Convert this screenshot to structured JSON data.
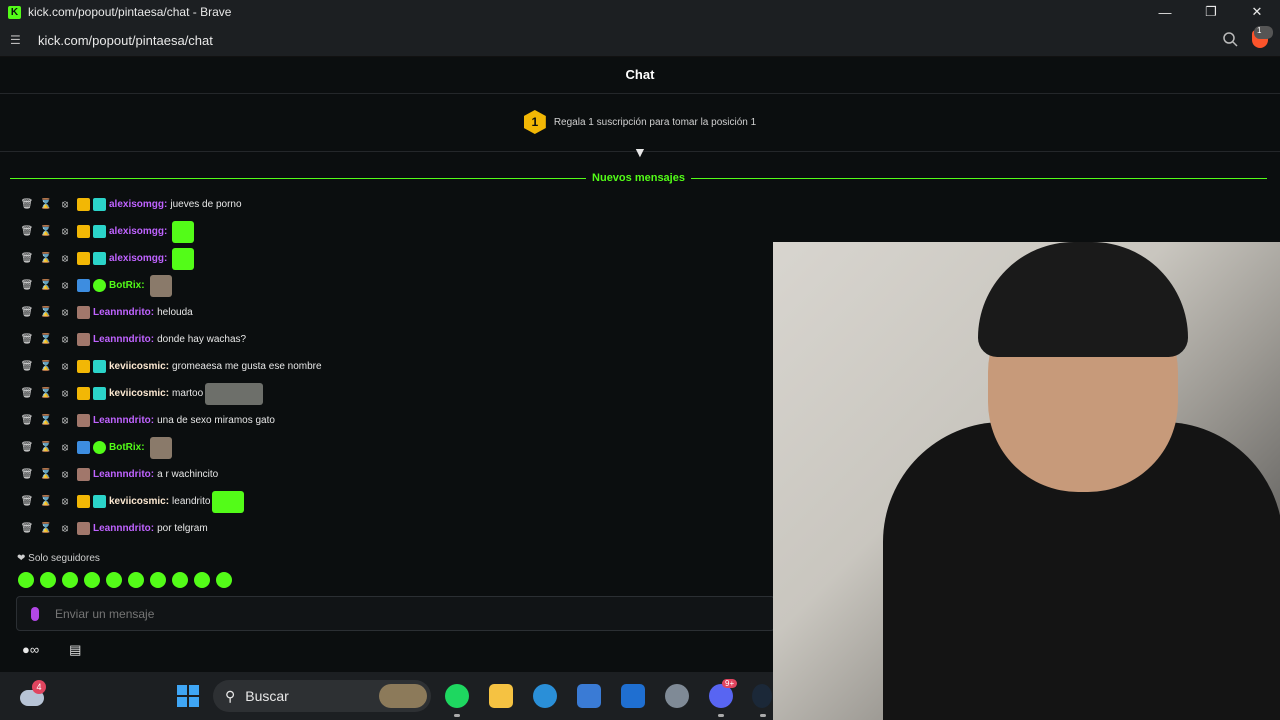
{
  "browser": {
    "window_title": "kick.com/popout/pintaesa/chat - Brave",
    "url": "kick.com/popout/pintaesa/chat",
    "brave_badge_count": "1"
  },
  "chat": {
    "header": "Chat",
    "gift_banner": {
      "position": "1",
      "text": "Regala 1 suscripción para tomar la posición 1"
    },
    "new_messages_label": "Nuevos mensajes",
    "followers_only": "Solo seguidores",
    "input_placeholder": "Enviar un mensaje",
    "messages": [
      {
        "user": "alexisomgg:",
        "text": "jueves de porno",
        "color": "#bf63ff"
      },
      {
        "user": "alexisomgg:",
        "text": "",
        "color": "#bf63ff"
      },
      {
        "user": "alexisomgg:",
        "text": "",
        "color": "#bf63ff"
      },
      {
        "user": "BotRix:",
        "text": "",
        "color": "#53fc18"
      },
      {
        "user": "Leannndrito:",
        "text": "helouda",
        "color": "#bf63ff"
      },
      {
        "user": "Leannndrito:",
        "text": "donde hay wachas?",
        "color": "#bf63ff"
      },
      {
        "user": "keviicosmic:",
        "text": "gromeaesa me gusta ese nombre",
        "color": "#fde9d2"
      },
      {
        "user": "keviicosmic:",
        "text": "martoo",
        "color": "#fde9d2"
      },
      {
        "user": "Leannndrito:",
        "text": "una de sexo miramos gato",
        "color": "#bf63ff"
      },
      {
        "user": "BotRix:",
        "text": "",
        "color": "#53fc18"
      },
      {
        "user": "Leannndrito:",
        "text": "a r wachincito",
        "color": "#bf63ff"
      },
      {
        "user": "keviicosmic:",
        "text": "leandrito",
        "color": "#fde9d2"
      },
      {
        "user": "Leannndrito:",
        "text": "por telgram",
        "color": "#bf63ff"
      }
    ]
  },
  "taskbar": {
    "weather_badge": "4",
    "search_label": "Buscar",
    "discord_badge": "9+"
  }
}
